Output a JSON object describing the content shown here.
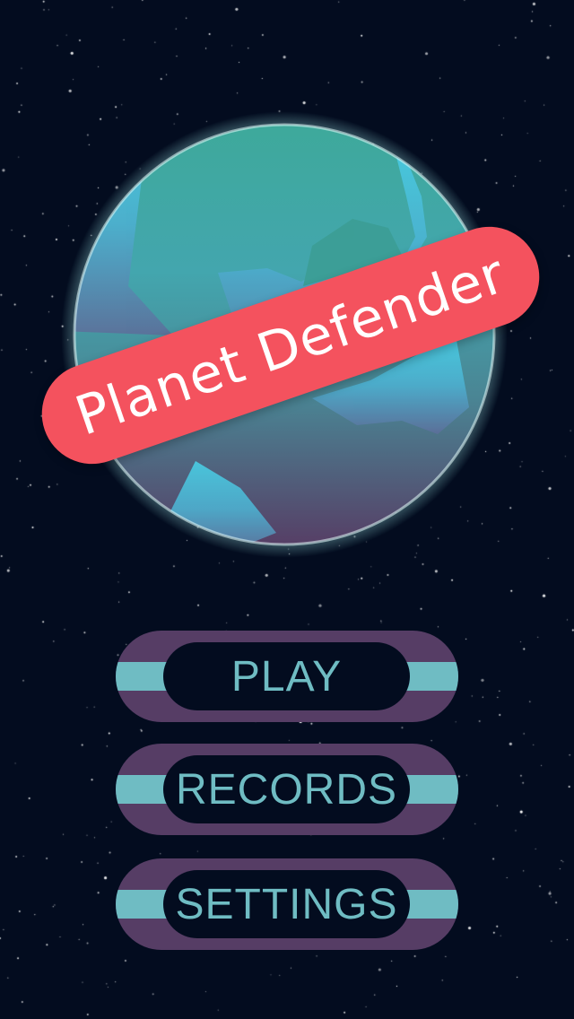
{
  "game": {
    "title": "Planet Defender"
  },
  "menu": {
    "items": [
      {
        "id": "play",
        "label": "PLAY"
      },
      {
        "id": "records",
        "label": "RECORDS"
      },
      {
        "id": "settings",
        "label": "SETTINGS"
      }
    ]
  },
  "colors": {
    "background": "#030c1f",
    "banner": "#f4525e",
    "button_outer": "#563d65",
    "button_stripe": "#6fbcc3",
    "button_text": "#6fbcc3",
    "planet_top": "#40a99a",
    "planet_bottom": "#533e64",
    "planet_glow": "#bff7f6"
  }
}
